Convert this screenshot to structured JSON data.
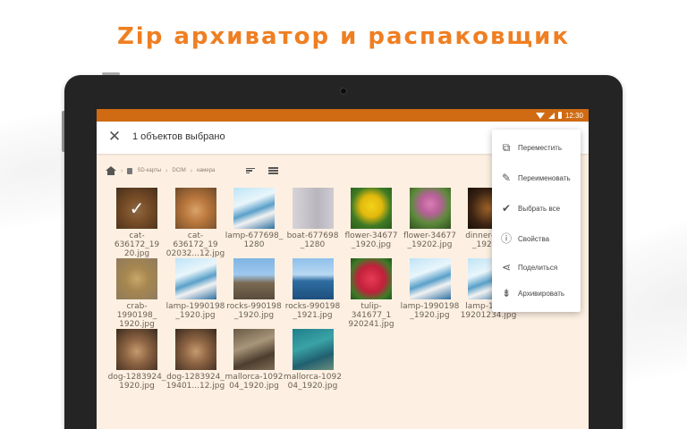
{
  "headline": "Zip архиватор и распаковщик",
  "colors": {
    "accent": "#ef7f22",
    "statusbar": "#d06b13",
    "screen_bg": "#fdf0e2"
  },
  "status": {
    "time": "12:30",
    "icons": [
      "wifi-icon",
      "signal-icon",
      "battery-icon"
    ]
  },
  "appbar": {
    "selection_title": "1 объектов выбрано",
    "close_icon": "close-icon"
  },
  "breadcrumb": {
    "items": [
      "SD-карты",
      "DCIM",
      "камера"
    ]
  },
  "files": [
    {
      "name": "cat-636172_19\n20.jpg",
      "selected": true,
      "thumb": "cat-photo"
    },
    {
      "name": "cat-636172_19\n02032...12.jpg",
      "selected": false,
      "thumb": "cat-photo"
    },
    {
      "name": "lamp-677698_\n1280",
      "selected": false,
      "thumb": "pier-photo"
    },
    {
      "name": "boat-677698\n_1280",
      "selected": false,
      "thumb": "boat-photo"
    },
    {
      "name": "flower-34677\n_1920.jpg",
      "selected": false,
      "thumb": "yellow-flower-photo"
    },
    {
      "name": "flower-34677\n_19202.jpg",
      "selected": false,
      "thumb": "pink-flower-photo"
    },
    {
      "name": "dinner-67...\n_1920...",
      "selected": false,
      "thumb": "dinner-photo"
    },
    {
      "name": "crab-1990198_\n1920.jpg",
      "selected": false,
      "thumb": "crab-photo"
    },
    {
      "name": "lamp-1990198\n_1920.jpg",
      "selected": false,
      "thumb": "pier-photo"
    },
    {
      "name": "rocks-990198\n_1920.jpg",
      "selected": false,
      "thumb": "rocks-photo"
    },
    {
      "name": "rocks-990198\n_1921.jpg",
      "selected": false,
      "thumb": "sea-photo"
    },
    {
      "name": "tulip-341677_1\n920241.jpg",
      "selected": false,
      "thumb": "tulip-photo"
    },
    {
      "name": "lamp-1990198\n_1920.jpg",
      "selected": false,
      "thumb": "pier-photo"
    },
    {
      "name": "lamp-199...\n19201234.jpg",
      "selected": false,
      "thumb": "pier-photo"
    },
    {
      "name": "dog-1283924_\n1920.jpg",
      "selected": false,
      "thumb": "dog-photo"
    },
    {
      "name": "dog-1283924_\n19401...12.jpg",
      "selected": false,
      "thumb": "dog-photo"
    },
    {
      "name": "mallorca-1092\n04_1920.jpg",
      "selected": false,
      "thumb": "mallorca-photo"
    },
    {
      "name": "mallorca-1092\n04_1920.jpg",
      "selected": false,
      "thumb": "mallorca-sea-photo"
    }
  ],
  "menu": {
    "items": [
      {
        "label": "Переместить",
        "icon": "move-icon"
      },
      {
        "label": "Переименовать",
        "icon": "pencil-icon"
      },
      {
        "label": "Выбрать все",
        "icon": "select-all-icon"
      },
      {
        "label": "Свойства",
        "icon": "info-icon"
      },
      {
        "label": "Поделиться",
        "icon": "share-icon"
      },
      {
        "label": "Архивировать",
        "icon": "archive-icon"
      }
    ]
  }
}
